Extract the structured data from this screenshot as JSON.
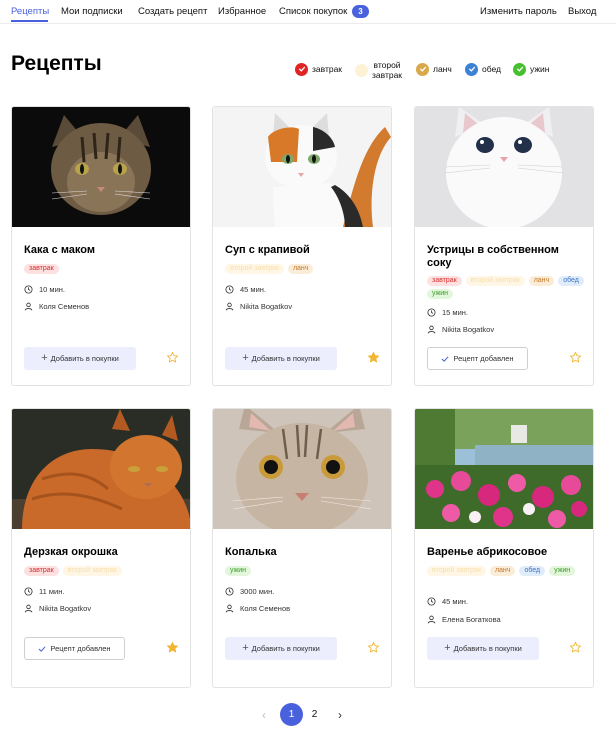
{
  "nav": {
    "items": [
      "Рецепты",
      "Мои подписки",
      "Создать рецепт",
      "Избранное",
      "Список покупок"
    ],
    "shopping_count": "3",
    "change_password": "Изменить пароль",
    "logout": "Выход"
  },
  "page": {
    "title": "Рецепты"
  },
  "legend": [
    {
      "label": "завтрак",
      "color": "#e02424",
      "checked": true
    },
    {
      "label_line1": "второй",
      "label_line2": "завтрак",
      "color": "#fdf1d6",
      "checked": false
    },
    {
      "label": "ланч",
      "color": "#d8a94a",
      "checked": true
    },
    {
      "label": "обед",
      "color": "#3b82d6",
      "checked": true
    },
    {
      "label": "ужин",
      "color": "#46c02e",
      "checked": true
    }
  ],
  "tag_colors": {
    "завтрак": {
      "bg": "#fde0e0",
      "fg": "#d72c2c"
    },
    "второй завтрак": {
      "bg": "#fff6e5",
      "fg": "#f5dfae"
    },
    "ланч": {
      "bg": "#fbecd8",
      "fg": "#c27a2a"
    },
    "обед": {
      "bg": "#e1ecfb",
      "fg": "#3a74c6"
    },
    "ужин": {
      "bg": "#e1f6da",
      "fg": "#3e9b2a"
    }
  },
  "recipes": [
    {
      "title": "Кака с маком",
      "tags": [
        "завтрак"
      ],
      "time": "10 мин.",
      "author": "Коля Семенов",
      "action": "Добавить в покупки",
      "favorite": false
    },
    {
      "title": "Суп с крапивой",
      "tags": [
        "второй завтрак",
        "ланч"
      ],
      "time": "45 мин.",
      "author": "Nikita Bogatkov",
      "action": "Добавить в покупки",
      "favorite": true
    },
    {
      "title": "Устрицы в собственном соку",
      "tags": [
        "завтрак",
        "второй завтрак",
        "ланч",
        "обед",
        "ужин"
      ],
      "time": "15 мин.",
      "author": "Nikita Bogatkov",
      "action": "Рецепт добавлен",
      "favorite": false
    },
    {
      "title": "Дерзкая окрошка",
      "tags": [
        "завтрак",
        "второй завтрак"
      ],
      "time": "11 мин.",
      "author": "Nikita Bogatkov",
      "action": "Рецепт добавлен",
      "favorite": true
    },
    {
      "title": "Копалька",
      "tags": [
        "ужин"
      ],
      "time": "3000 мин.",
      "author": "Коля Семенов",
      "action": "Добавить в покупки",
      "favorite": false
    },
    {
      "title": "Варенье абрикосовое",
      "tags": [
        "второй завтрак",
        "ланч",
        "обед",
        "ужин"
      ],
      "time": "45 мин.",
      "author": "Елена Богаткова",
      "action": "Добавить в покупки",
      "favorite": false
    }
  ],
  "pagination": {
    "prev": "‹",
    "pages": [
      "1",
      "2"
    ],
    "current": "1",
    "next": "›"
  }
}
